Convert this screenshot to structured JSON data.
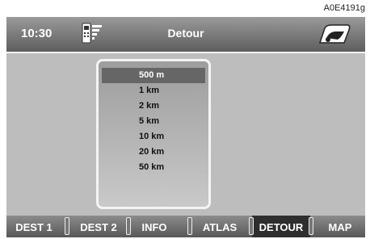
{
  "ref_code": "A0E4191g",
  "header": {
    "time": "10:30",
    "title": "Detour",
    "phone_icon": "phone-signal-icon",
    "car_icon": "car-icon"
  },
  "detour_list": {
    "items": [
      "500 m",
      "1 km",
      "2 km",
      "5 km",
      "10 km",
      "20 km",
      "50 km"
    ],
    "selected": "500 m"
  },
  "tabs": [
    {
      "label": "DEST 1"
    },
    {
      "label": "DEST 2"
    },
    {
      "label": "INFO"
    },
    {
      "label": "ATLAS"
    },
    {
      "label": "DETOUR",
      "active": true
    },
    {
      "label": "MAP"
    }
  ],
  "colors": {
    "active_tab": "#2e2e2e",
    "selected_row": "#666666",
    "screen_bg": "#bdbdbd"
  }
}
